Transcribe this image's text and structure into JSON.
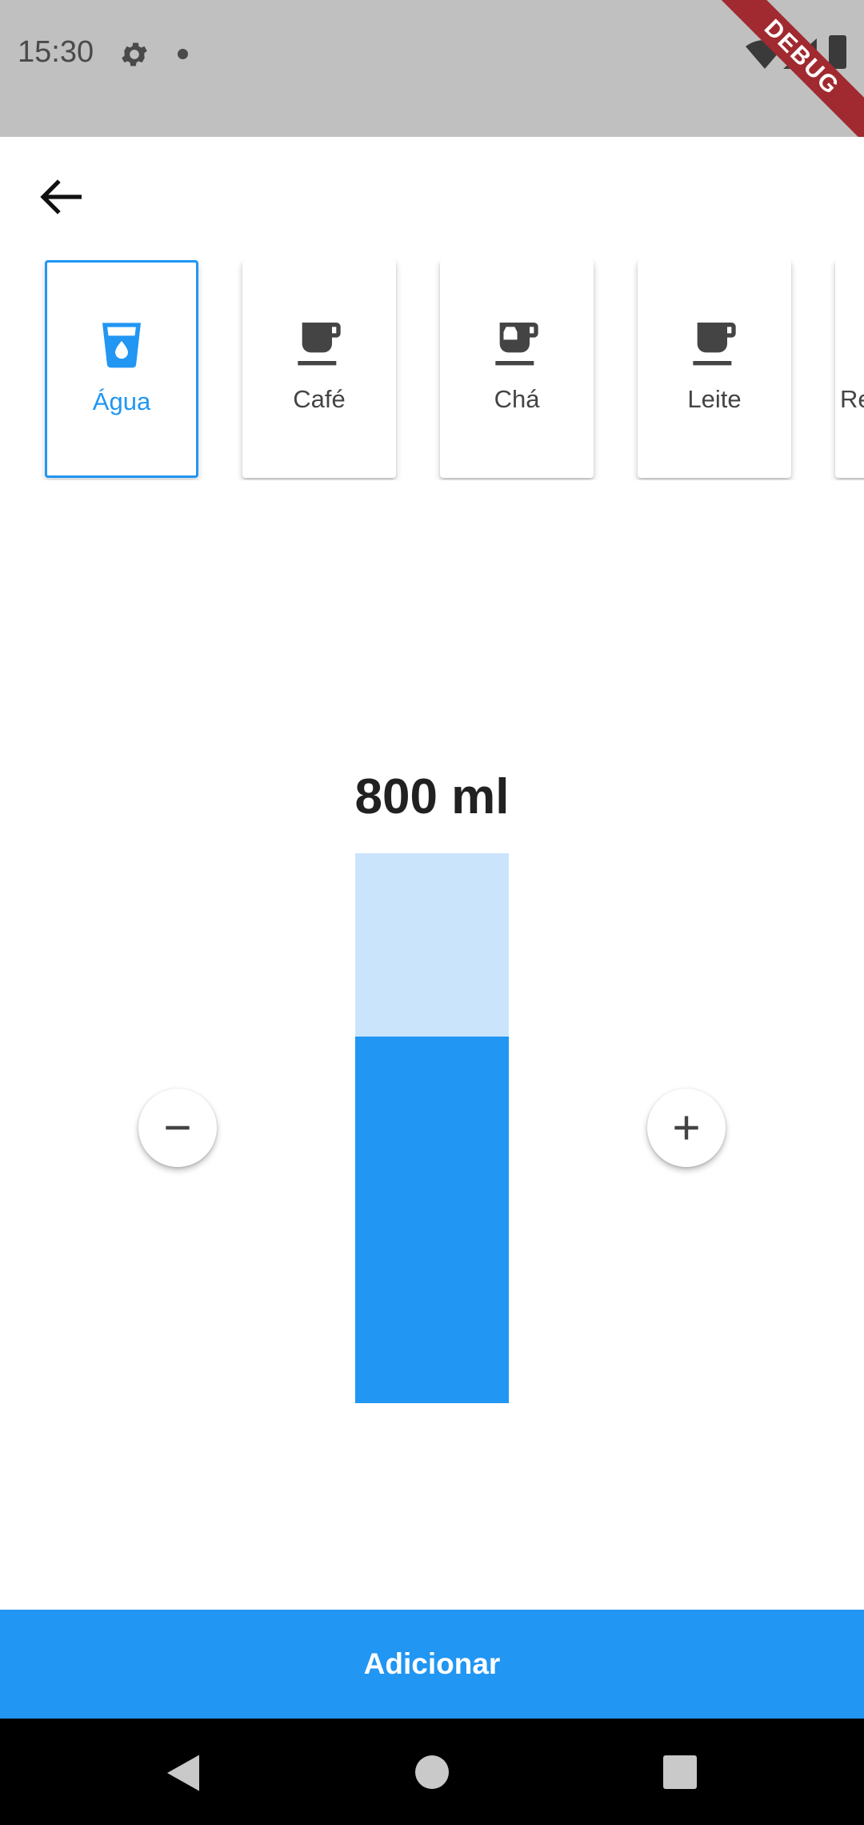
{
  "status_bar": {
    "time": "15:30",
    "icons": [
      "gear-icon",
      "notification-dot-icon",
      "wifi-icon",
      "signal-icon",
      "battery-icon"
    ],
    "debug_banner": "DEBUG"
  },
  "app_bar": {
    "back_icon": "arrow-back-icon"
  },
  "drink_types": [
    {
      "label": "Água",
      "icon": "water-cup-icon",
      "selected": true
    },
    {
      "label": "Café",
      "icon": "coffee-cup-icon",
      "selected": false
    },
    {
      "label": "Chá",
      "icon": "tea-cup-icon",
      "selected": false
    },
    {
      "label": "Leite",
      "icon": "coffee-cup-icon",
      "selected": false
    },
    {
      "label": "Re",
      "icon": "",
      "selected": false
    }
  ],
  "amount": {
    "label": "800 ml",
    "fill_fraction": 0.667
  },
  "controls": {
    "decrease_icon": "minus-icon",
    "increase_icon": "plus-icon"
  },
  "add_button": {
    "label": "Adicionar"
  },
  "colors": {
    "accent": "#2196f3",
    "gauge_empty": "#c9e4fb",
    "status_bar": "#c0c0c0",
    "debug_banner": "#a02a2f"
  }
}
